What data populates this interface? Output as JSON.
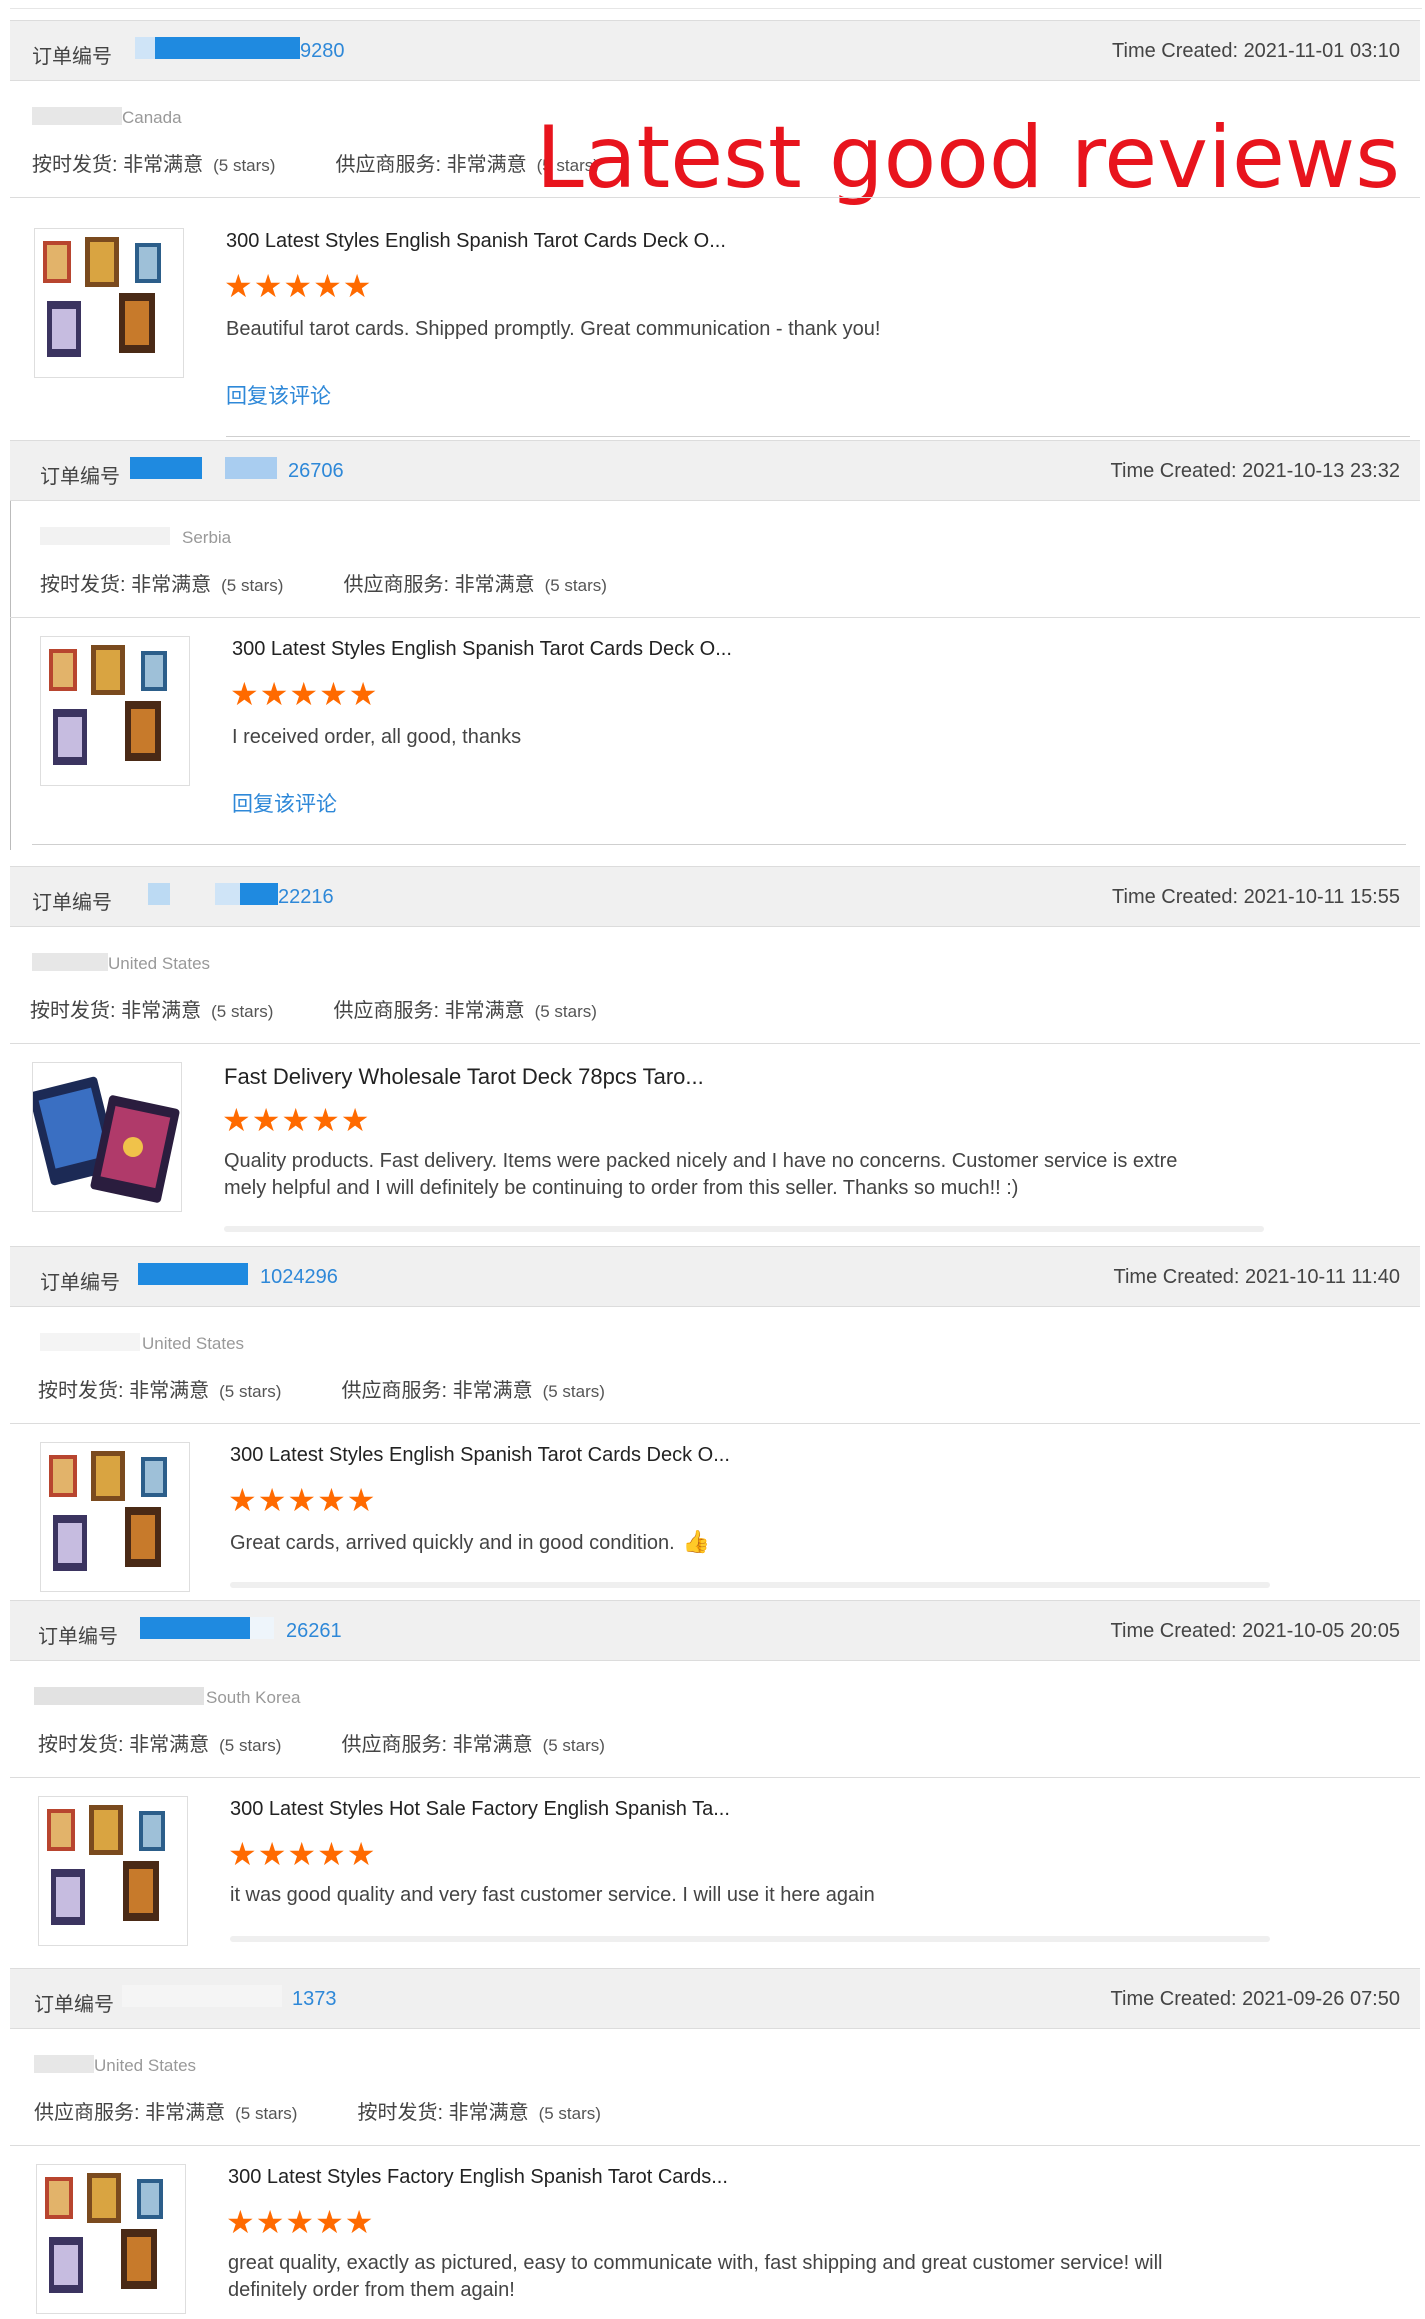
{
  "banner": "Latest good reviews",
  "labels": {
    "order_no": "订单编号",
    "time_created": "Time Created:",
    "shipping": "按时发货: 非常满意",
    "service": "供应商服务: 非常满意",
    "five_stars": "(5 stars)",
    "reply": "回复该评论",
    "stars_glyphs": "★★★★★",
    "thumbs_up_icon": "👍"
  },
  "reviews": [
    {
      "order_suffix": "9280",
      "time": "2021-11-01 03:10",
      "country": "Canada",
      "product": "300 Latest Styles English Spanish Tarot Cards Deck O...",
      "text": "Beautiful tarot cards. Shipped promptly. Great communication - thank you!",
      "rating": 5
    },
    {
      "order_suffix": "26706",
      "time": "2021-10-13 23:32",
      "country": "Serbia",
      "product": "300 Latest Styles English Spanish Tarot Cards Deck O...",
      "text": "I received order, all good, thanks",
      "rating": 5
    },
    {
      "order_suffix": "22216",
      "time": "2021-10-11 15:55",
      "country": "United States",
      "product": "Fast Delivery Wholesale Tarot Deck 78pcs Taro...",
      "text": "Quality products. Fast delivery. Items were packed nicely and I have no concerns. Customer service is extre mely helpful and I will definitely be continuing to order from this seller. Thanks so much!! :)",
      "rating": 5
    },
    {
      "order_suffix": "1024296",
      "time": "2021-10-11 11:40",
      "country": "United States",
      "product": "300 Latest Styles English Spanish Tarot Cards Deck O...",
      "text": "Great cards, arrived quickly and in good condition.",
      "rating": 5
    },
    {
      "order_suffix": "26261",
      "time": "2021-10-05 20:05",
      "country": "South Korea",
      "product": "300 Latest Styles Hot Sale Factory English Spanish Ta...",
      "text": "it was good quality and very fast customer service. I will use it here again",
      "rating": 5
    },
    {
      "order_suffix": "1373",
      "time": "2021-09-26 07:50",
      "country": "United States",
      "product": "300 Latest Styles Factory English Spanish Tarot Cards...",
      "text": "great quality, exactly as pictured, easy to communicate with, fast shipping and great customer service! will definitely order from them again!",
      "rating": 5
    }
  ]
}
